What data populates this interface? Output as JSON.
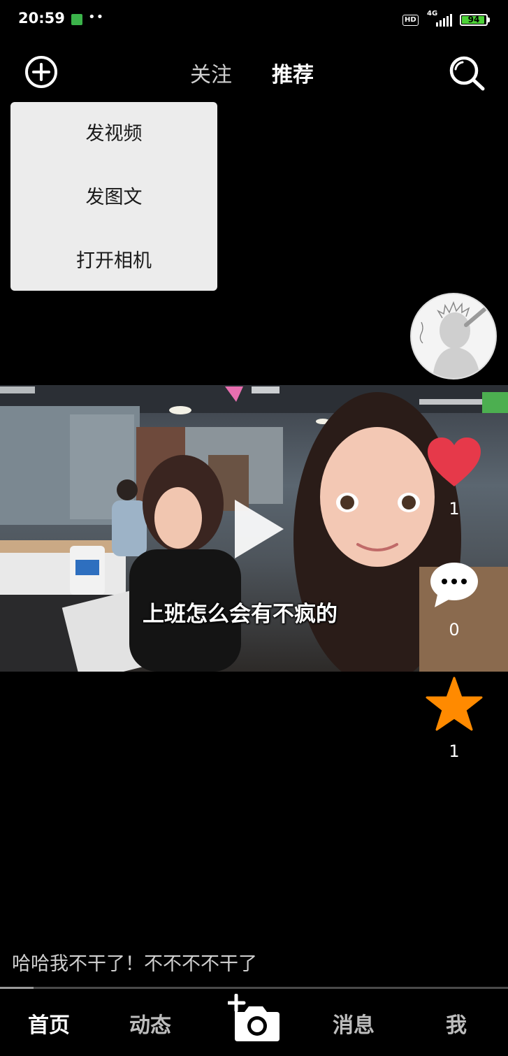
{
  "status_bar": {
    "time": "20:59",
    "dots": "••",
    "hd": "HD",
    "network": "4G",
    "battery": "94",
    "battery_level": 0.94
  },
  "top_bar": {
    "tab_follow": "关注",
    "tab_recommend": "推荐",
    "active_tab": "推荐"
  },
  "menu": {
    "items": [
      {
        "label": "发视频"
      },
      {
        "label": "发图文"
      },
      {
        "label": "打开相机"
      }
    ]
  },
  "video": {
    "subtitle": "上班怎么会有不疯的",
    "caption": "哈哈我不干了！不不不不干了",
    "progress": 0.066
  },
  "actions": {
    "like_count": "1",
    "comment_count": "0",
    "favorite_count": "1",
    "colors": {
      "like": "#e6394a",
      "favorite": "#ff8a00",
      "comment": "#ffffff"
    }
  },
  "bottom_nav": {
    "home": "首页",
    "feed": "动态",
    "messages": "消息",
    "me": "我",
    "active": "首页"
  }
}
